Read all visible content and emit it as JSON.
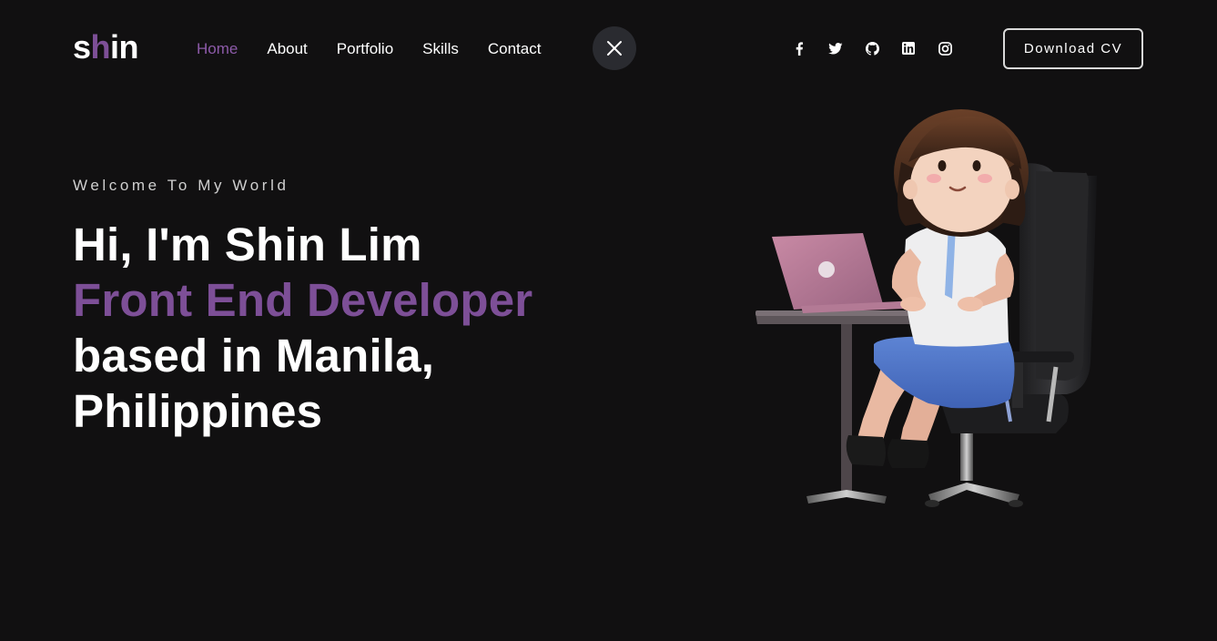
{
  "logo": {
    "part1": "s",
    "part2": "h",
    "part3": "in"
  },
  "nav": {
    "items": [
      {
        "label": "Home"
      },
      {
        "label": "About"
      },
      {
        "label": "Portfolio"
      },
      {
        "label": "Skills"
      },
      {
        "label": "Contact"
      }
    ],
    "active_color": "#8c5aa8"
  },
  "socials": [
    "facebook-icon",
    "twitter-icon",
    "github-icon",
    "linkedin-icon",
    "instagram-icon"
  ],
  "header": {
    "cv_label": "Download CV"
  },
  "hero": {
    "welcome": "Welcome To My World",
    "line1": "Hi, I'm Shin Lim",
    "role": "Front End Developer",
    "line3": "based in Manila,",
    "line4": "Philippines"
  },
  "colors": {
    "background": "#111011",
    "accent": "#7d4f97",
    "close_button_bg": "#2a2b30"
  }
}
